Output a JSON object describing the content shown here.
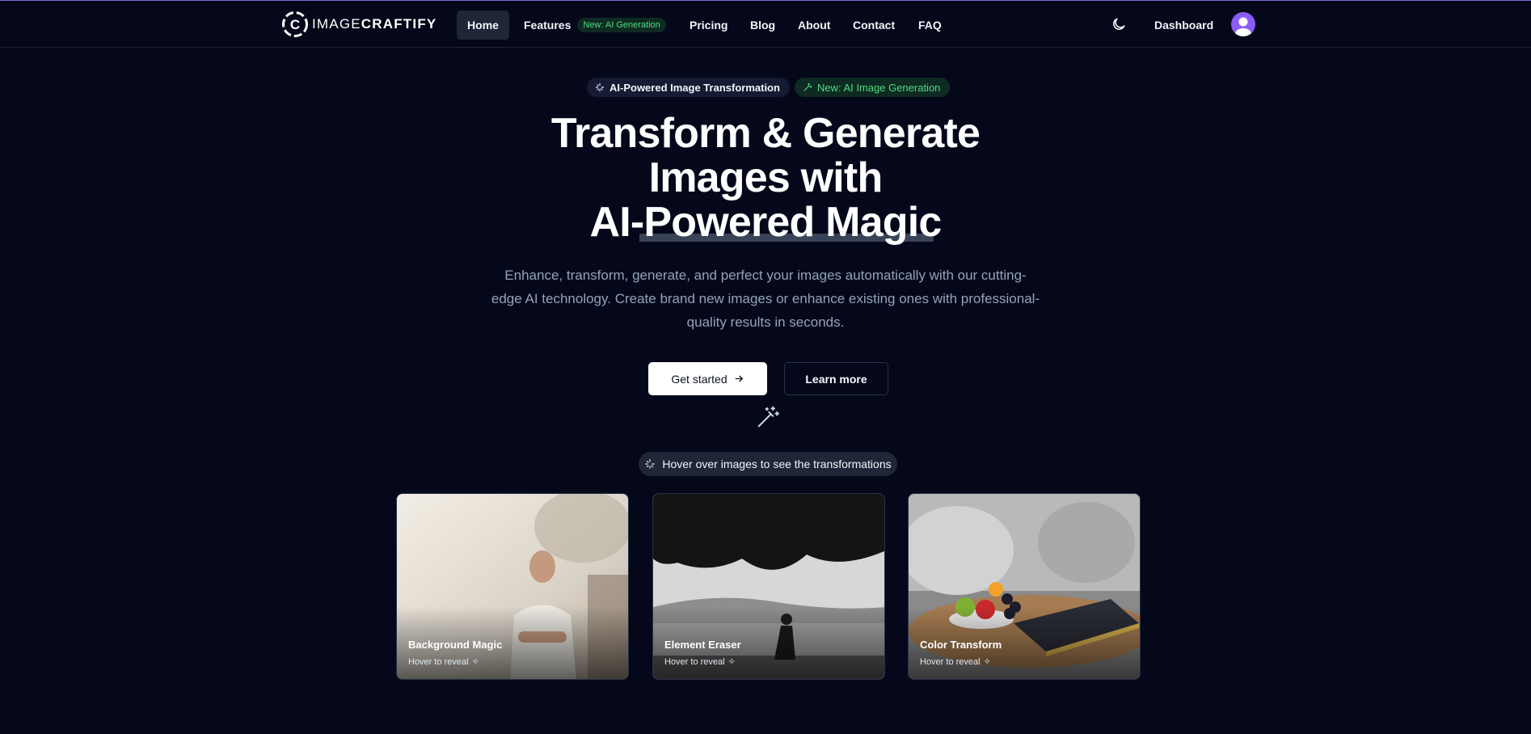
{
  "brand": {
    "name_light": "IMAGE",
    "name_bold": "CRAFTIFY"
  },
  "nav": {
    "home": "Home",
    "features": "Features",
    "features_badge": "New: AI Generation",
    "pricing": "Pricing",
    "blog": "Blog",
    "about": "About",
    "contact": "Contact",
    "faq": "FAQ",
    "dashboard": "Dashboard"
  },
  "badges": {
    "primary": "AI-Powered Image Transformation",
    "secondary": "New: AI Image Generation"
  },
  "hero": {
    "title_line1": "Transform & Generate",
    "title_line2": "Images with",
    "title_line3": "AI-Powered Magic",
    "subtitle": "Enhance, transform, generate, and perfect your images automatically with our cutting-edge AI technology. Create brand new images or enhance existing ones with professional-quality results in seconds."
  },
  "buttons": {
    "get_started": "Get started",
    "learn_more": "Learn more"
  },
  "hint": "Hover over images to see the transformations",
  "cards": [
    {
      "title": "Background Magic",
      "hint": "Hover to reveal"
    },
    {
      "title": "Element Eraser",
      "hint": "Hover to reveal"
    },
    {
      "title": "Color Transform",
      "hint": "Hover to reveal"
    }
  ],
  "colors": {
    "background": "#04081a",
    "accent_green": "#4ade80",
    "avatar": "#8b5cf6"
  },
  "icons": [
    "logo-icon",
    "moon-icon",
    "user-icon",
    "sparkles-icon",
    "wand-icon",
    "arrow-right-icon"
  ]
}
